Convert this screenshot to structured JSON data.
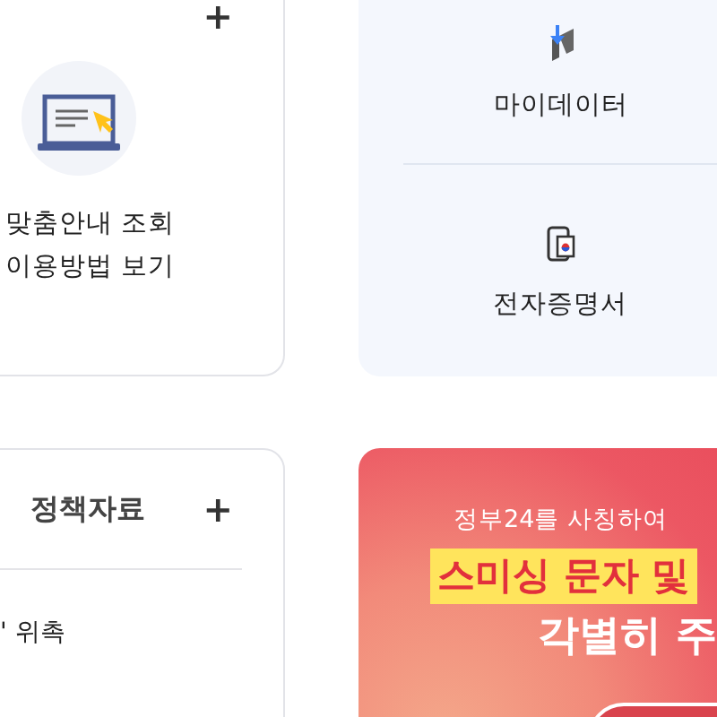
{
  "service_card": {
    "plus": "+",
    "lines": [
      "맞춤안내 조회",
      "이용방법 보기"
    ]
  },
  "quick_menu": {
    "items": [
      {
        "kind": "mydata",
        "label": "마이데이터"
      },
      {
        "kind": "certificate",
        "label": "전자증명서"
      }
    ]
  },
  "news_card": {
    "tabs": [
      {
        "label": "정책자료",
        "selected": false
      }
    ],
    "plus": "+",
    "items": [
      "' 위촉"
    ]
  },
  "banner": {
    "subtitle": "정부24를 사칭하여",
    "highlight": "스미싱 문자 및",
    "title": "각별히 주"
  }
}
